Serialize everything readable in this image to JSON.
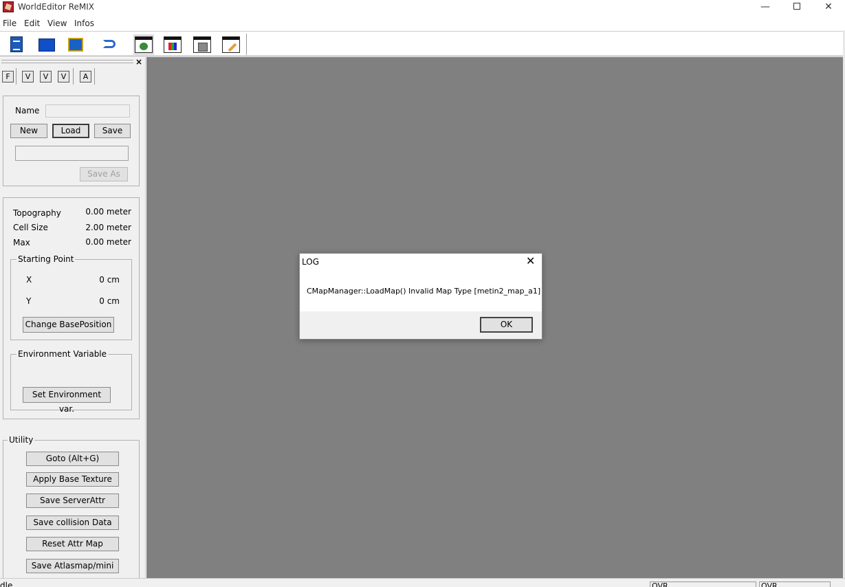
{
  "window": {
    "title": "WorldEditor ReMIX",
    "minimize": "—",
    "close": "✕"
  },
  "menu": [
    "File",
    "Edit",
    "View",
    "Infos"
  ],
  "toolbar": {
    "icons": [
      "new-document-icon",
      "open-folder-icon",
      "monitor-icon",
      "undo-icon",
      "map-view-icon",
      "texture-view-icon",
      "object-view-icon",
      "brush-view-icon"
    ],
    "pressed": "map-view-icon"
  },
  "panel": {
    "close": "×",
    "tabs": [
      "F",
      "V",
      "V",
      "V",
      "A"
    ],
    "file_group": {
      "name_label": "Name",
      "name_value": "",
      "new_label": "New",
      "load_label": "Load",
      "save_label": "Save",
      "path_value": "",
      "save_as_label": "Save As"
    },
    "map_info": {
      "topography_label": "Topography",
      "topography_value": "0.00 meter",
      "cellsize_label": "Cell Size",
      "cellsize_value": "2.00 meter",
      "max_label": "Max",
      "max_value": "0.00 meter"
    },
    "starting_point": {
      "title": "Starting Point",
      "x_label": "X",
      "x_value": "0 cm",
      "y_label": "Y",
      "y_value": "0 cm",
      "change_label": "Change BasePosition"
    },
    "environment": {
      "title": "Environment Variable",
      "set_label": "Set Environment var."
    },
    "utility": {
      "title": "Utility",
      "buttons": [
        "Goto (Alt+G)",
        "Apply Base Texture",
        "Save ServerAttr",
        "Save collision Data",
        "Reset Attr Map",
        "Save Atlasmap/mini"
      ]
    }
  },
  "statusbar": {
    "text": "dle",
    "pane1": "OVR",
    "pane2": "OVR"
  },
  "dialog": {
    "title": "LOG",
    "close": "✕",
    "message": "CMapManager::LoadMap() Invalid Map Type [metin2_map_a1]",
    "ok_label": "OK"
  },
  "colors": {
    "viewport": "#808080",
    "panel": "#f0f0f0"
  }
}
